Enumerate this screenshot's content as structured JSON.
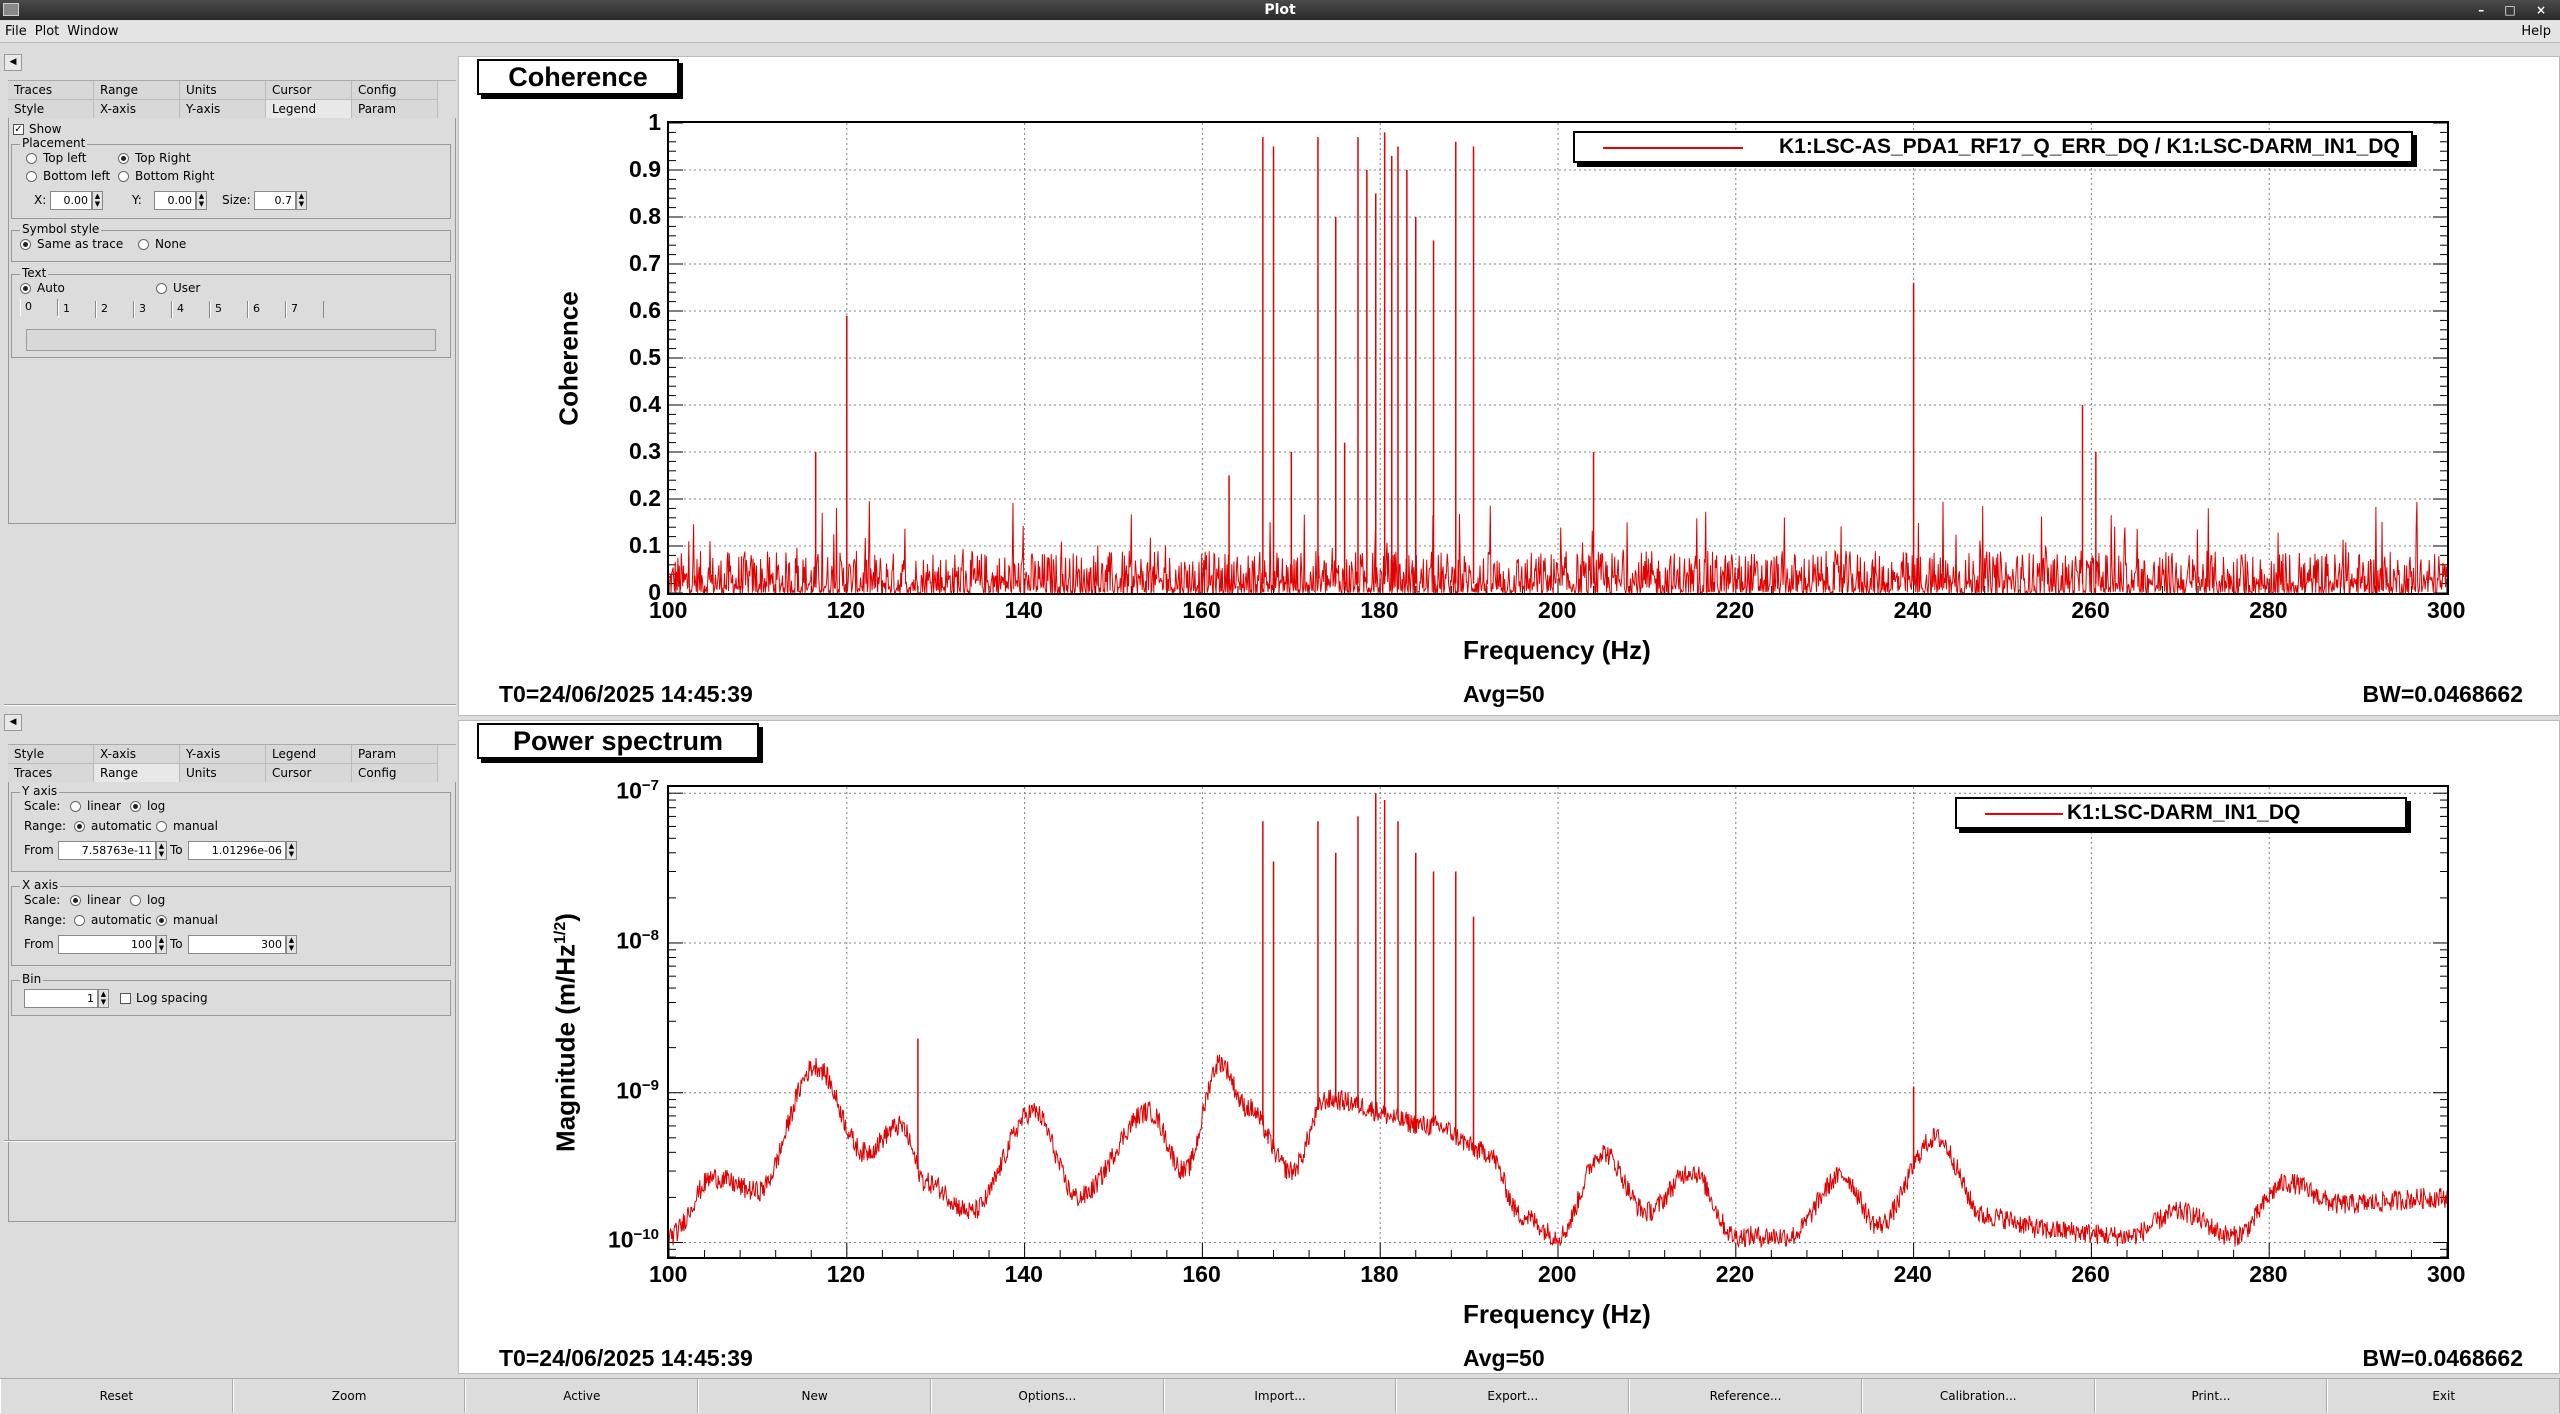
{
  "window": {
    "title": "Plot"
  },
  "menu": {
    "file": "File",
    "plot": "Plot",
    "window": "Window",
    "help": "Help"
  },
  "panel1": {
    "tabs_row1": [
      "Traces",
      "Range",
      "Units",
      "Cursor",
      "Config"
    ],
    "tabs_row2": [
      "Style",
      "X-axis",
      "Y-axis",
      "Legend",
      "Param"
    ],
    "selected_tab": "Legend",
    "show_label": "Show",
    "placement": {
      "title": "Placement",
      "top_left": "Top left",
      "top_right": "Top Right",
      "bottom_left": "Bottom left",
      "bottom_right": "Bottom Right",
      "x_label": "X:",
      "x_value": "0.00",
      "y_label": "Y:",
      "y_value": "0.00",
      "size_label": "Size:",
      "size_value": "0.7"
    },
    "symbol_style": {
      "title": "Symbol style",
      "same": "Same as trace",
      "none": "None"
    },
    "text": {
      "title": "Text",
      "auto": "Auto",
      "user": "User",
      "tabs": [
        "0",
        "1",
        "2",
        "3",
        "4",
        "5",
        "6",
        "7"
      ]
    }
  },
  "panel2": {
    "tabs_row1": [
      "Style",
      "X-axis",
      "Y-axis",
      "Legend",
      "Param"
    ],
    "tabs_row2": [
      "Traces",
      "Range",
      "Units",
      "Cursor",
      "Config"
    ],
    "selected_tab": "Range",
    "yaxis": {
      "title": "Y axis",
      "scale_label": "Scale:",
      "linear": "linear",
      "log": "log",
      "range_label": "Range:",
      "automatic": "automatic",
      "manual": "manual",
      "from_label": "From",
      "from_value": "7.58763e-11",
      "to_label": "To",
      "to_value": "1.01296e-06"
    },
    "xaxis": {
      "title": "X axis",
      "scale_label": "Scale:",
      "linear": "linear",
      "log": "log",
      "range_label": "Range:",
      "automatic": "automatic",
      "manual": "manual",
      "from_label": "From",
      "from_value": "100",
      "to_label": "To",
      "to_value": "300"
    },
    "bin": {
      "title": "Bin",
      "value": "1",
      "log_spacing": "Log spacing"
    }
  },
  "plot1": {
    "title": "Coherence",
    "ylabel": "Coherence",
    "xlabel": "Frequency (Hz)",
    "legend": "K1:LSC-AS_PDA1_RF17_Q_ERR_DQ / K1:LSC-DARM_IN1_DQ",
    "t0": "T0=24/06/2025 14:45:39",
    "avg": "Avg=50",
    "bw": "BW=0.0468662",
    "yticks": [
      "0",
      "0.1",
      "0.2",
      "0.3",
      "0.4",
      "0.5",
      "0.6",
      "0.7",
      "0.8",
      "0.9",
      "1"
    ],
    "xticks": [
      "100",
      "120",
      "140",
      "160",
      "180",
      "200",
      "220",
      "240",
      "260",
      "280",
      "300"
    ]
  },
  "plot2": {
    "title": "Power spectrum",
    "ylabel": "Magnitude (m/Hz",
    "ylabel_sup": "1/2",
    "ylabel_end": ")",
    "xlabel": "Frequency (Hz)",
    "legend": "K1:LSC-DARM_IN1_DQ",
    "t0": "T0=24/06/2025 14:45:39",
    "avg": "Avg=50",
    "bw": "BW=0.0468662",
    "yticks": [
      {
        "base": "10",
        "exp": "−10"
      },
      {
        "base": "10",
        "exp": "−9"
      },
      {
        "base": "10",
        "exp": "−8"
      },
      {
        "base": "10",
        "exp": "−7"
      }
    ],
    "xticks": [
      "100",
      "120",
      "140",
      "160",
      "180",
      "200",
      "220",
      "240",
      "260",
      "280",
      "300"
    ]
  },
  "bottom_buttons": [
    "Reset",
    "Zoom",
    "Active",
    "New",
    "Options...",
    "Import...",
    "Export...",
    "Reference...",
    "Calibration...",
    "Print...",
    "Exit"
  ],
  "colors": {
    "trace": "#e00000",
    "grid": "#808080"
  },
  "chart_data": [
    {
      "type": "line",
      "title": "Coherence",
      "xlabel": "Frequency (Hz)",
      "ylabel": "Coherence",
      "xlim": [
        100,
        300
      ],
      "ylim": [
        0,
        1
      ],
      "grid": true,
      "legend_position": "top-right",
      "series": [
        {
          "name": "K1:LSC-AS_PDA1_RF17_Q_ERR_DQ / K1:LSC-DARM_IN1_DQ"
        }
      ],
      "peaks": [
        {
          "x": 116.5,
          "y": 0.3
        },
        {
          "x": 120,
          "y": 0.59
        },
        {
          "x": 163,
          "y": 0.25
        },
        {
          "x": 166.8,
          "y": 0.97
        },
        {
          "x": 168,
          "y": 0.95
        },
        {
          "x": 170,
          "y": 0.3
        },
        {
          "x": 173,
          "y": 0.97
        },
        {
          "x": 175,
          "y": 0.8
        },
        {
          "x": 176,
          "y": 0.32
        },
        {
          "x": 177.5,
          "y": 0.97
        },
        {
          "x": 178.5,
          "y": 0.9
        },
        {
          "x": 179.5,
          "y": 0.85
        },
        {
          "x": 180.5,
          "y": 0.98
        },
        {
          "x": 181.3,
          "y": 0.93
        },
        {
          "x": 182,
          "y": 0.95
        },
        {
          "x": 183,
          "y": 0.9
        },
        {
          "x": 184,
          "y": 0.8
        },
        {
          "x": 186,
          "y": 0.75
        },
        {
          "x": 188.5,
          "y": 0.96
        },
        {
          "x": 190.5,
          "y": 0.95
        },
        {
          "x": 204,
          "y": 0.3
        },
        {
          "x": 240,
          "y": 0.66
        },
        {
          "x": 259,
          "y": 0.4
        },
        {
          "x": 260.5,
          "y": 0.3
        }
      ],
      "baseline_range": [
        0,
        0.1
      ]
    },
    {
      "type": "line",
      "title": "Power spectrum",
      "xlabel": "Frequency (Hz)",
      "ylabel": "Magnitude (m/Hz^1/2)",
      "xlim": [
        100,
        300
      ],
      "ylim": [
        8e-11,
        1.1e-07
      ],
      "yscale": "log",
      "grid": true,
      "legend_position": "top-right",
      "series": [
        {
          "name": "K1:LSC-DARM_IN1_DQ"
        }
      ],
      "envelope": [
        {
          "x": 100,
          "y": 1.1e-10
        },
        {
          "x": 105,
          "y": 2.7e-10
        },
        {
          "x": 110,
          "y": 2.2e-10
        },
        {
          "x": 116.5,
          "y": 1.5e-09
        },
        {
          "x": 122,
          "y": 4e-10
        },
        {
          "x": 126,
          "y": 6e-10
        },
        {
          "x": 129,
          "y": 2.5e-10
        },
        {
          "x": 134,
          "y": 1.6e-10
        },
        {
          "x": 141,
          "y": 7.5e-10
        },
        {
          "x": 146,
          "y": 2e-10
        },
        {
          "x": 154,
          "y": 7.5e-10
        },
        {
          "x": 158,
          "y": 3e-10
        },
        {
          "x": 162,
          "y": 1.6e-09
        },
        {
          "x": 165,
          "y": 8e-10
        },
        {
          "x": 170,
          "y": 3e-10
        },
        {
          "x": 174,
          "y": 9e-10
        },
        {
          "x": 186,
          "y": 6e-10
        },
        {
          "x": 192,
          "y": 4e-10
        },
        {
          "x": 196,
          "y": 1.5e-10
        },
        {
          "x": 200,
          "y": 1.1e-10
        },
        {
          "x": 205,
          "y": 4e-10
        },
        {
          "x": 210,
          "y": 1.6e-10
        },
        {
          "x": 215,
          "y": 3e-10
        },
        {
          "x": 220,
          "y": 1.1e-10
        },
        {
          "x": 226,
          "y": 1.1e-10
        },
        {
          "x": 232,
          "y": 2.8e-10
        },
        {
          "x": 236,
          "y": 1.3e-10
        },
        {
          "x": 242.5,
          "y": 5e-10
        },
        {
          "x": 248,
          "y": 1.5e-10
        },
        {
          "x": 256,
          "y": 1.2e-10
        },
        {
          "x": 264,
          "y": 1.1e-10
        },
        {
          "x": 270,
          "y": 1.6e-10
        },
        {
          "x": 276,
          "y": 1.1e-10
        },
        {
          "x": 282,
          "y": 2.5e-10
        },
        {
          "x": 288,
          "y": 1.8e-10
        },
        {
          "x": 300,
          "y": 2e-10
        }
      ],
      "peaks": [
        {
          "x": 128,
          "y": 2.3e-09
        },
        {
          "x": 166.8,
          "y": 6.5e-08
        },
        {
          "x": 168,
          "y": 3.5e-08
        },
        {
          "x": 173,
          "y": 6.5e-08
        },
        {
          "x": 175,
          "y": 4e-08
        },
        {
          "x": 177.5,
          "y": 7e-08
        },
        {
          "x": 179.5,
          "y": 1e-07
        },
        {
          "x": 180.5,
          "y": 9e-08
        },
        {
          "x": 182,
          "y": 6.5e-08
        },
        {
          "x": 184,
          "y": 4e-08
        },
        {
          "x": 186,
          "y": 3e-08
        },
        {
          "x": 188.5,
          "y": 3e-08
        },
        {
          "x": 190.5,
          "y": 1.5e-08
        },
        {
          "x": 240,
          "y": 1.1e-09
        }
      ]
    }
  ]
}
